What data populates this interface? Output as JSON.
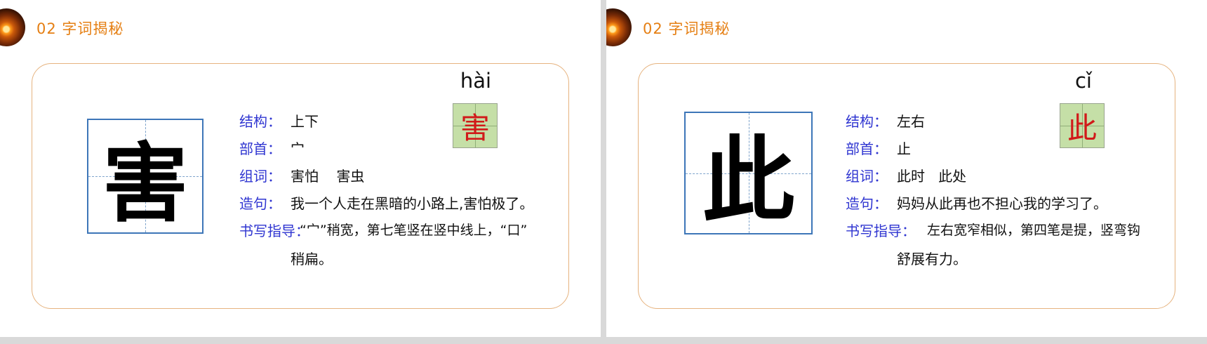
{
  "slides": [
    {
      "section_title": "02  字词揭秘",
      "character": "害",
      "pinyin": "hài",
      "labels": {
        "structure": "结构：",
        "radical": "部首：",
        "words": "组词：",
        "sentence": "造句：",
        "guide": "书写指导："
      },
      "structure": "上下",
      "radical": "宀",
      "words": "害怕    害虫",
      "sentence": "我一个人走在黑暗的小路上,害怕极了。",
      "guide_line1": "“宀”稍宽，第七笔竖在竖中线上，“口”",
      "guide_line2": "稍扁。"
    },
    {
      "section_title": "02  字词揭秘",
      "character": "此",
      "pinyin": "cǐ",
      "labels": {
        "structure": "结构：",
        "radical": "部首：",
        "words": "组词：",
        "sentence": "造句：",
        "guide": "书写指导："
      },
      "structure": "左右",
      "radical": "止",
      "words": "此时   此处",
      "sentence": "妈妈从此再也不担心我的学习了。",
      "guide_line1": "左右宽窄相似，第四笔是提，竖弯钩",
      "guide_line2": "舒展有力。"
    }
  ]
}
